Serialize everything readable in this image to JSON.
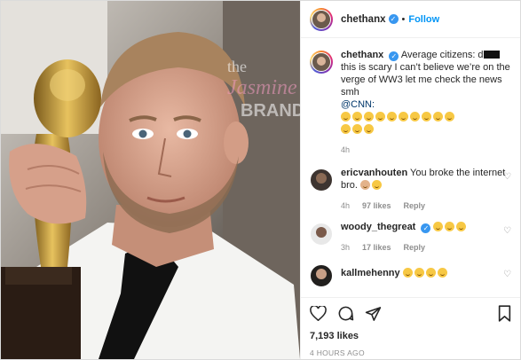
{
  "header": {
    "username": "chethanx",
    "verified_glyph": "✓",
    "separator": "•",
    "follow_label": "Follow"
  },
  "caption": {
    "username": "chethanx",
    "text_before_redaction": "Average citizens: d",
    "text_after_redaction": " this is scary I can’t believe we’re on the verge of WW3 let me check the news smh",
    "mention": "@CNN:",
    "emoji_name": "rolling-on-floor-laughing-emoji",
    "emoji_count": 13,
    "time": "4h"
  },
  "comments": [
    {
      "username": "ericvanhouten",
      "text": "You broke the internet bro.",
      "emoji_names": [
        "man-facepalming-emoji",
        "tears-of-joy-emoji"
      ],
      "time": "4h",
      "likes": "97 likes",
      "reply": "Reply"
    },
    {
      "username": "woody_thegreat",
      "verified": true,
      "text": "",
      "emoji_names": [
        "rolling-on-floor-laughing-emoji",
        "rolling-on-floor-laughing-emoji",
        "rolling-on-floor-laughing-emoji"
      ],
      "time": "3h",
      "likes": "17 likes",
      "reply": "Reply"
    },
    {
      "username": "kallmehenny",
      "text": "",
      "emoji_names": [
        "tears-of-joy-emoji",
        "tears-of-joy-emoji",
        "tears-of-joy-emoji",
        "tears-of-joy-emoji"
      ]
    }
  ],
  "watermark": {
    "line1": "the",
    "line2": "Jasmine",
    "line3": "BRAND"
  },
  "actions": {
    "icons": [
      "heart-icon",
      "comment-icon",
      "share-icon",
      "bookmark-icon"
    ],
    "likes": "7,193 likes",
    "timestamp": "4 HOURS AGO"
  },
  "colors": {
    "accent": "#0095f6",
    "verified": "#3897f0",
    "meta": "#8e8e8e"
  }
}
